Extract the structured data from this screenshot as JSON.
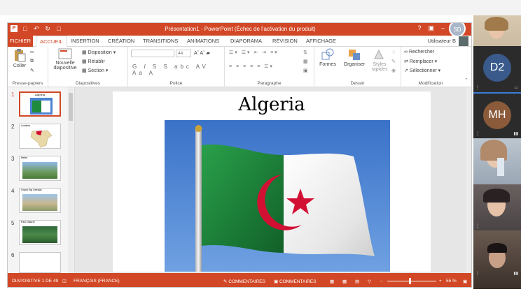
{
  "window": {
    "title": "Présentation1 - PowerPoint (Échec de l'activation du produit)",
    "help": "?",
    "user_initials": "SD"
  },
  "tabs": {
    "fichier": "FICHIER",
    "accueil": "ACCUEIL",
    "insertion": "INSERTION",
    "creation": "CRÉATION",
    "transitions": "TRANSITIONS",
    "animations": "ANIMATIONS",
    "diaporama": "DIAPORAMA",
    "revision": "RÉVISION",
    "affichage": "AFFICHAGE",
    "user": "Utilisateur B"
  },
  "ribbon": {
    "coller": "Coller",
    "nouvelle_diapositive_1": "Nouvelle",
    "nouvelle_diapositive_2": "diapositive",
    "disposition": "Disposition",
    "retablir": "Rétablir",
    "section": "Section",
    "font_size": "44",
    "formes": "Formes",
    "organiser": "Organiser",
    "styles_1": "Styles",
    "styles_2": "rapides",
    "rechercher": "Rechercher",
    "remplacer": "Remplacer",
    "selectionner": "Sélectionner",
    "groups": {
      "presse_papiers": "Presse-papiers",
      "diapositives": "Diapositives",
      "police": "Police",
      "paragraphe": "Paragraphe",
      "dessin": "Dessin",
      "modification": "Modification"
    }
  },
  "thumbnails": [
    {
      "num": "1",
      "label": "Algeria"
    },
    {
      "num": "2",
      "label": "Location"
    },
    {
      "num": "3",
      "label": "Relief"
    },
    {
      "num": "4",
      "label": "Grand Erg Oriental"
    },
    {
      "num": "5",
      "label": "Parc Naturel"
    },
    {
      "num": "6",
      "label": ""
    }
  ],
  "slide": {
    "title": "Algeria"
  },
  "status": {
    "slide_counter": "DIAPOSITIVE 1 DE 49",
    "language": "FRANÇAIS (FRANCE)",
    "notes": "COMMENTAIRES",
    "comments": "COMMENTAIRES",
    "zoom": "55 %"
  },
  "participants": [
    {
      "kind": "video",
      "name": ""
    },
    {
      "kind": "initials",
      "initials": "D2",
      "color": "#3a5a8c"
    },
    {
      "kind": "initials",
      "initials": "MH",
      "color": "#8a5a3a"
    },
    {
      "kind": "video",
      "name": ""
    },
    {
      "kind": "video",
      "name": ""
    },
    {
      "kind": "video",
      "name": ""
    }
  ],
  "colors": {
    "accent": "#d24726",
    "flag_green": "#1e8a3c",
    "flag_red": "#d21034"
  }
}
